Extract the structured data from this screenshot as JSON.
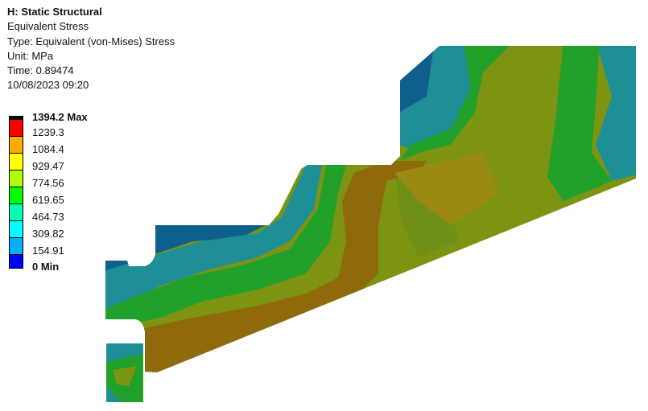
{
  "header": {
    "title": "H: Static Structural",
    "result": "Equivalent Stress",
    "type": "Type: Equivalent (von-Mises) Stress",
    "unit": "Unit: MPa",
    "time": "Time: 0.89474",
    "date": "10/08/2023 09:20"
  },
  "legend": {
    "max_label": "1394.2 Max",
    "min_label": "0 Min",
    "values": [
      "1239.3",
      "1084.4",
      "929.47",
      "774.56",
      "619.65",
      "464.73",
      "309.82",
      "154.91"
    ],
    "colors": [
      "#000000",
      "#ff0000",
      "#ffaa00",
      "#ffff00",
      "#b0ff00",
      "#00ff00",
      "#00ffb0",
      "#00ffff",
      "#00b0ff",
      "#0000ff"
    ]
  }
}
